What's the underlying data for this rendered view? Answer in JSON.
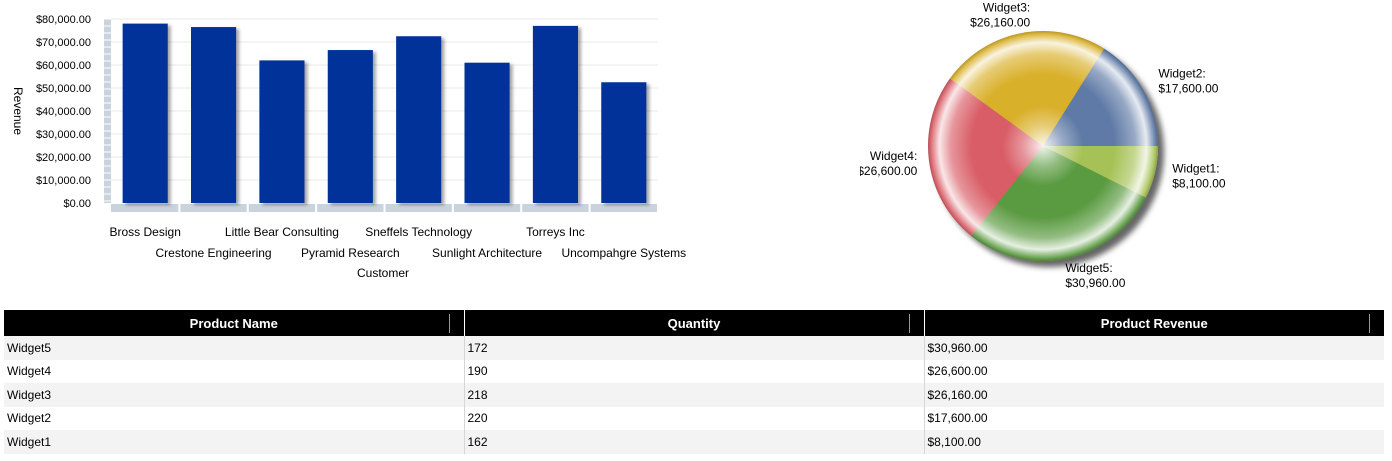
{
  "chart_data": [
    {
      "type": "bar",
      "categories": [
        "Bross Design",
        "Crestone Engineering",
        "Little Bear Consulting",
        "Pyramid Research",
        "Sneffels Technology",
        "Sunlight Architecture",
        "Torreys Inc",
        "Uncompahgre Systems"
      ],
      "values": [
        78000,
        76500,
        62000,
        66500,
        72500,
        61000,
        77000,
        52500
      ],
      "xlabel": "Customer",
      "ylabel": "Revenue",
      "ylim": [
        0,
        80000
      ],
      "yticks": [
        "$0.00",
        "$10,000.00",
        "$20,000.00",
        "$30,000.00",
        "$40,000.00",
        "$50,000.00",
        "$60,000.00",
        "$70,000.00",
        "$80,000.00"
      ],
      "grid": true,
      "colors": {
        "bar": "#003399"
      }
    },
    {
      "type": "pie",
      "slices": [
        {
          "label": "Widget1:",
          "value_label": "$8,100.00",
          "value": 8100,
          "color": "#a6c257"
        },
        {
          "label": "Widget5:",
          "value_label": "$30,960.00",
          "value": 30960,
          "color": "#5a9a3f"
        },
        {
          "label": "Widget4:",
          "value_label": "$26,600.00",
          "value": 26600,
          "color": "#d95d66"
        },
        {
          "label": "Widget3:",
          "value_label": "$26,160.00",
          "value": 26160,
          "color": "#d9b02c"
        },
        {
          "label": "Widget2:",
          "value_label": "$17,600.00",
          "value": 17600,
          "color": "#5e7aa6"
        }
      ]
    }
  ],
  "table": {
    "headers": [
      "Product Name",
      "Quantity",
      "Product Revenue"
    ],
    "rows": [
      [
        "Widget5",
        "172",
        "$30,960.00"
      ],
      [
        "Widget4",
        "190",
        "$26,600.00"
      ],
      [
        "Widget3",
        "218",
        "$26,160.00"
      ],
      [
        "Widget2",
        "220",
        "$17,600.00"
      ],
      [
        "Widget1",
        "162",
        "$8,100.00"
      ]
    ]
  }
}
